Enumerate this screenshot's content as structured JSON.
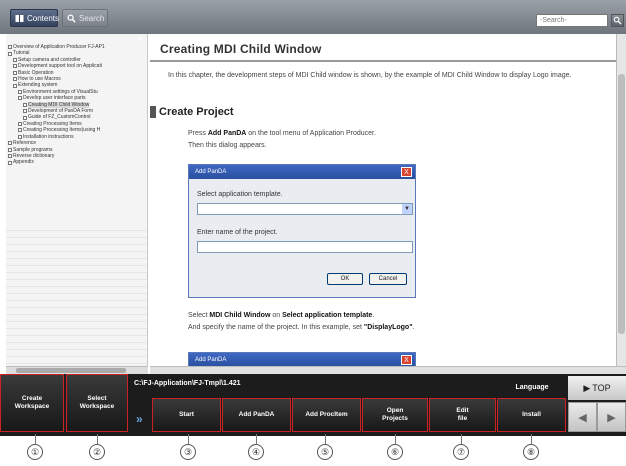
{
  "topbar": {
    "tab_contents": "Contents",
    "tab_search": "Search",
    "search_placeholder": "-Search-",
    "search_go_icon": "search-go-icon"
  },
  "tree": {
    "items": [
      {
        "label": "Overview of Application Producer FJ-AP1",
        "indent": 0
      },
      {
        "label": "Tutorial",
        "indent": 0
      },
      {
        "label": "Setup camera and controller",
        "indent": 1
      },
      {
        "label": "Development support tool on Applicati",
        "indent": 1
      },
      {
        "label": "Basic Operation",
        "indent": 1
      },
      {
        "label": "How to use Macros",
        "indent": 1
      },
      {
        "label": "Extending system",
        "indent": 1
      },
      {
        "label": "Environment settings of VisualStu",
        "indent": 2
      },
      {
        "label": "Develop user interface parts",
        "indent": 2
      },
      {
        "label": "Creating MDI Child Window",
        "indent": 3,
        "selected": true
      },
      {
        "label": "Development of PanDA Form",
        "indent": 3
      },
      {
        "label": "Guide of FZ_CustomControl",
        "indent": 3
      },
      {
        "label": "Creating Processing Items",
        "indent": 2
      },
      {
        "label": "Creating Processing Items(using H",
        "indent": 2
      },
      {
        "label": "Installation instructions",
        "indent": 2
      },
      {
        "label": "Reference",
        "indent": 0
      },
      {
        "label": "Sample programs",
        "indent": 0
      },
      {
        "label": "Reverse dictionary",
        "indent": 0
      },
      {
        "label": "Appendix",
        "indent": 0
      }
    ]
  },
  "main": {
    "title": "Creating MDI Child Window",
    "intro": "In this chapter, the development steps of MDI Child window is shown, by the example of MDI Child Window to display Logo image.",
    "section": "Create Project",
    "para1_pre": "Press ",
    "para1_bold": "Add PanDA",
    "para1_post": " on the tool menu of Application Producer.",
    "para1_line2": "Then this dialog appears.",
    "para2_a": "Select ",
    "para2_b": "MDI Child Window",
    "para2_c": " on ",
    "para2_d": "Select application template",
    "para2_e": ".",
    "para2_line2_pre": "And specify the name of the project. In this example, set ",
    "para2_line2_bold": "\"DisplayLogo\"",
    "para2_line2_post": "."
  },
  "dialog": {
    "title": "Add PanDA",
    "close": "X",
    "label_template": "Select application template.",
    "label_name": "Enter name of the project.",
    "ok": "OK",
    "cancel": "Cancel"
  },
  "dialog2": {
    "title": "Add PanDA",
    "close": "X"
  },
  "toolbar": {
    "create_workspace": "Create\nWorkspace",
    "select_workspace": "Select\nWorkspace",
    "path": "C:\\FJ-Application\\FJ-Tmpl\\1.421",
    "chevron": "»",
    "start": "Start",
    "add_panda": "Add PanDA",
    "add_procitem": "Add ProcItem",
    "open_projects": "Open\nProjects",
    "edit_file": "Edit\nfile",
    "install": "Install",
    "language": "Language",
    "top": "TOP",
    "prev": "◀",
    "next": "▶"
  },
  "callouts": [
    "①",
    "②",
    "③",
    "④",
    "⑤",
    "⑥",
    "⑦",
    "⑧"
  ]
}
